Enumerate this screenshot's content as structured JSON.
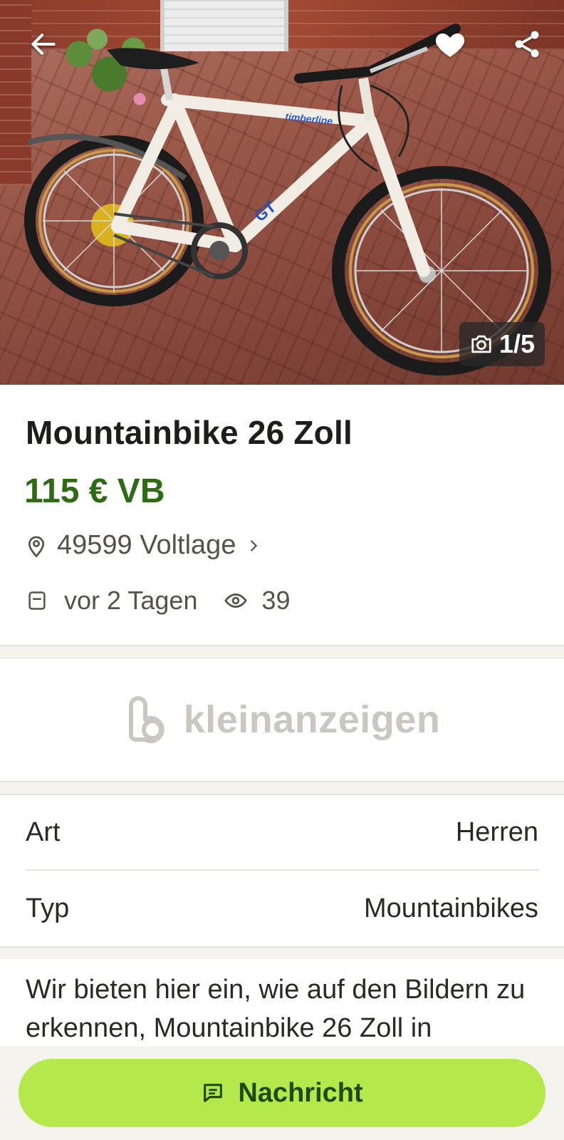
{
  "gallery": {
    "photo_counter": "1/5",
    "photo_description_icon": "bike-photo"
  },
  "actions": {
    "back_icon": "arrow-left-icon",
    "favorite_icon": "heart-icon",
    "share_icon": "share-icon"
  },
  "listing": {
    "title": "Mountainbike 26 Zoll",
    "price": "115 € VB",
    "location": "49599 Voltlage",
    "posted": "vor 2 Tagen",
    "views": "39"
  },
  "brand": {
    "name": "kleinanzeigen"
  },
  "attributes": [
    {
      "label": "Art",
      "value": "Herren"
    },
    {
      "label": "Typ",
      "value": "Mountainbikes"
    }
  ],
  "description": {
    "text": "Wir bieten hier ein, wie auf den Bildern zu erkennen, Mountainbike 26 Zoll in"
  },
  "bottom": {
    "message_label": "Nachricht"
  },
  "colors": {
    "price_green": "#2f6b14",
    "cta_green": "#b5e84a",
    "cta_text": "#1f4a0e",
    "muted_text": "#55524d"
  }
}
